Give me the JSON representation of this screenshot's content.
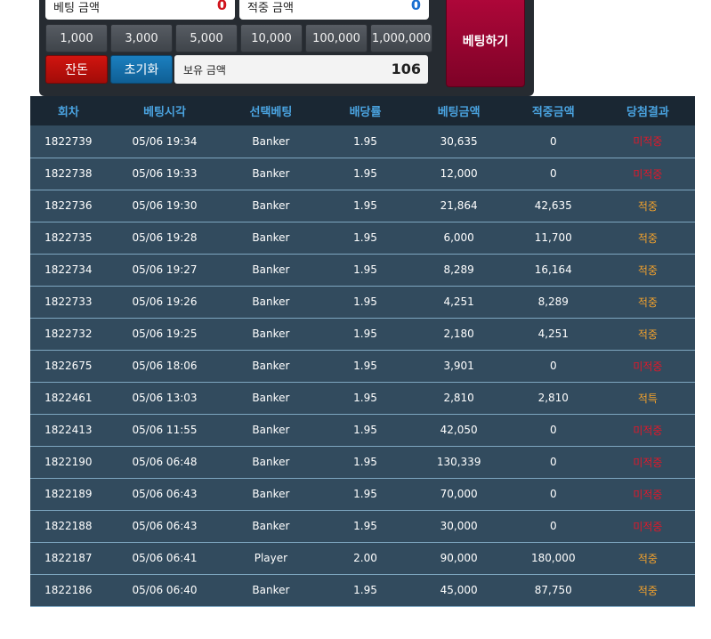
{
  "bet_panel": {
    "bet_amount_label": "베팅 금액",
    "bet_amount_value": "0",
    "win_amount_label": "적중 금액",
    "win_amount_value": "0",
    "chips": [
      "1,000",
      "3,000",
      "5,000",
      "10,000",
      "100,000",
      "1,000,000"
    ],
    "balance_button": "잔돈",
    "reset_button": "초기화",
    "holding_label": "보유 금액",
    "holding_value": "106",
    "bet_button": "베팅하기"
  },
  "table": {
    "headers": [
      "회차",
      "베팅시각",
      "선택베팅",
      "배당률",
      "베팅금액",
      "적중금액",
      "당첨결과"
    ],
    "rows": [
      {
        "round": "1822739",
        "time": "05/06 19:34",
        "pick": "Banker",
        "odds": "1.95",
        "bet": "30,635",
        "win": "0",
        "result": "미적중",
        "status": "lose"
      },
      {
        "round": "1822738",
        "time": "05/06 19:33",
        "pick": "Banker",
        "odds": "1.95",
        "bet": "12,000",
        "win": "0",
        "result": "미적중",
        "status": "lose"
      },
      {
        "round": "1822736",
        "time": "05/06 19:30",
        "pick": "Banker",
        "odds": "1.95",
        "bet": "21,864",
        "win": "42,635",
        "result": "적중",
        "status": "win"
      },
      {
        "round": "1822735",
        "time": "05/06 19:28",
        "pick": "Banker",
        "odds": "1.95",
        "bet": "6,000",
        "win": "11,700",
        "result": "적중",
        "status": "win"
      },
      {
        "round": "1822734",
        "time": "05/06 19:27",
        "pick": "Banker",
        "odds": "1.95",
        "bet": "8,289",
        "win": "16,164",
        "result": "적중",
        "status": "win"
      },
      {
        "round": "1822733",
        "time": "05/06 19:26",
        "pick": "Banker",
        "odds": "1.95",
        "bet": "4,251",
        "win": "8,289",
        "result": "적중",
        "status": "win"
      },
      {
        "round": "1822732",
        "time": "05/06 19:25",
        "pick": "Banker",
        "odds": "1.95",
        "bet": "2,180",
        "win": "4,251",
        "result": "적중",
        "status": "win"
      },
      {
        "round": "1822675",
        "time": "05/06 18:06",
        "pick": "Banker",
        "odds": "1.95",
        "bet": "3,901",
        "win": "0",
        "result": "미적중",
        "status": "lose"
      },
      {
        "round": "1822461",
        "time": "05/06 13:03",
        "pick": "Banker",
        "odds": "1.95",
        "bet": "2,810",
        "win": "2,810",
        "result": "적특",
        "status": "win"
      },
      {
        "round": "1822413",
        "time": "05/06 11:55",
        "pick": "Banker",
        "odds": "1.95",
        "bet": "42,050",
        "win": "0",
        "result": "미적중",
        "status": "lose"
      },
      {
        "round": "1822190",
        "time": "05/06 06:48",
        "pick": "Banker",
        "odds": "1.95",
        "bet": "130,339",
        "win": "0",
        "result": "미적중",
        "status": "lose"
      },
      {
        "round": "1822189",
        "time": "05/06 06:43",
        "pick": "Banker",
        "odds": "1.95",
        "bet": "70,000",
        "win": "0",
        "result": "미적중",
        "status": "lose"
      },
      {
        "round": "1822188",
        "time": "05/06 06:43",
        "pick": "Banker",
        "odds": "1.95",
        "bet": "30,000",
        "win": "0",
        "result": "미적중",
        "status": "lose"
      },
      {
        "round": "1822187",
        "time": "05/06 06:41",
        "pick": "Player",
        "odds": "2.00",
        "bet": "90,000",
        "win": "180,000",
        "result": "적중",
        "status": "win"
      },
      {
        "round": "1822186",
        "time": "05/06 06:40",
        "pick": "Banker",
        "odds": "1.95",
        "bet": "45,000",
        "win": "87,750",
        "result": "적중",
        "status": "win"
      }
    ]
  },
  "colors": {
    "win_text": "#f2a12c",
    "lose_text": "#e0182a",
    "header_text": "#4aa3e0",
    "row_bg": "#324b5e"
  }
}
